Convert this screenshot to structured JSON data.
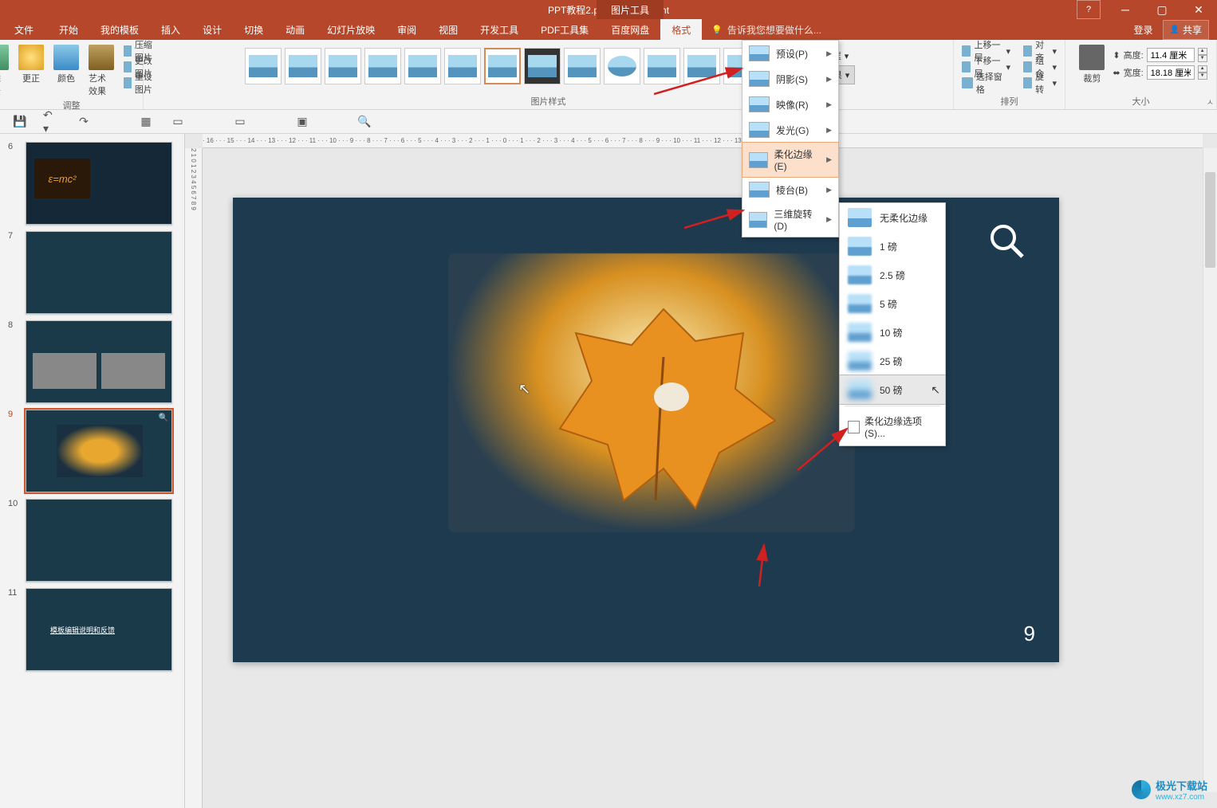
{
  "titlebar": {
    "doc_title": "PPT教程2.pptx - PowerPoint",
    "tool_tab": "图片工具",
    "help": "?"
  },
  "menubar": {
    "tabs": {
      "file": "文件",
      "home": "开始",
      "mytpl": "我的模板",
      "insert": "插入",
      "design": "设计",
      "transition": "切换",
      "animation": "动画",
      "slideshow": "幻灯片放映",
      "review": "审阅",
      "view": "视图",
      "dev": "开发工具",
      "pdf": "PDF工具集",
      "baidu": "百度网盘",
      "format": "格式"
    },
    "tellme": "告诉我您想要做什么...",
    "login": "登录",
    "share": "共享"
  },
  "ribbon": {
    "remove_bg": "删除背景",
    "corrections": "更正",
    "color": "颜色",
    "artistic": "艺术效果",
    "compress": "压缩图片",
    "change": "更改图片",
    "reset": "重设图片",
    "adjust_group": "调整",
    "style_group": "图片样式",
    "border": "图片边框",
    "effects": "图片效果",
    "bring_fwd": "上移一层",
    "send_back": "下移一层",
    "selection_pane": "选择窗格",
    "align": "对齐",
    "group": "组合",
    "rotate": "旋转",
    "arrange_group": "排列",
    "crop": "裁剪",
    "height_label": "高度:",
    "height_val": "11.4 厘米",
    "width_label": "宽度:",
    "width_val": "18.18 厘米",
    "size_group": "大小"
  },
  "effect_menu": {
    "preset": "预设(P)",
    "shadow": "阴影(S)",
    "reflection": "映像(R)",
    "glow": "发光(G)",
    "soft_edges": "柔化边缘(E)",
    "bevel": "棱台(B)",
    "rotation3d": "三维旋转(D)"
  },
  "soft_edges_submenu": {
    "none": "无柔化边缘",
    "pt1": "1 磅",
    "pt25": "2.5 磅",
    "pt5": "5 磅",
    "pt10": "10 磅",
    "pt25b": "25 磅",
    "pt50": "50 磅",
    "options": "柔化边缘选项(S)..."
  },
  "slides": {
    "n6": "6",
    "n7": "7",
    "n8": "8",
    "n9": "9",
    "n10": "10",
    "n11": "11",
    "s11_text": "模板编辑说明和反馈"
  },
  "canvas": {
    "page_num": "9"
  },
  "ruler": {
    "h": "· 16 · · · 15 · · · 14 · · · 13 · · · 12 · · · 11 · · · 10 · · · 9 · · · 8 · · · 7 · · · 6 · · · 5 · · · 4 · · · 3 · · · 2 · · · 1 · · · 0 · · · 1 · · · 2 · · · 3 · · · 4 · · · 5 · · · 6 · · · 7 · · · 8 · · · 9 · · · 10 · · · 11 · · · 12 · · · 13 · · · 14 · · · 15 · · · 16 ·",
    "v": "2  1  0  1  2  3  4  5  6  7  8  9"
  },
  "watermark": {
    "name": "极光下载站",
    "url": "www.xz7.com"
  }
}
